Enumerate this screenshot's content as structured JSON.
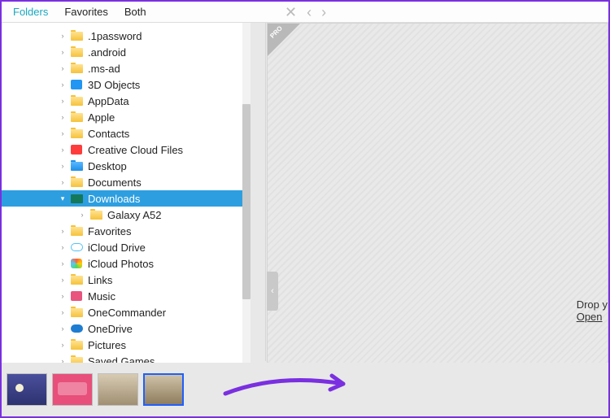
{
  "tabs": {
    "folders": "Folders",
    "favorites": "Favorites",
    "both": "Both",
    "active": "folders"
  },
  "nav": {
    "close": "✕",
    "back": "‹",
    "forward": "›"
  },
  "tree": [
    {
      "label": ".1password",
      "icon": "folder-yellow",
      "chev": "right"
    },
    {
      "label": ".android",
      "icon": "folder-yellow",
      "chev": "right"
    },
    {
      "label": ".ms-ad",
      "icon": "folder-yellow",
      "chev": "right"
    },
    {
      "label": "3D Objects",
      "icon": "icon-3d",
      "chev": "right"
    },
    {
      "label": "AppData",
      "icon": "folder-yellow",
      "chev": "right"
    },
    {
      "label": "Apple",
      "icon": "folder-yellow",
      "chev": "right"
    },
    {
      "label": "Contacts",
      "icon": "folder-yellow",
      "chev": "right"
    },
    {
      "label": "Creative Cloud Files",
      "icon": "icon-cc",
      "chev": "right"
    },
    {
      "label": "Desktop",
      "icon": "folder-blue",
      "chev": "right"
    },
    {
      "label": "Documents",
      "icon": "folder-yellow",
      "chev": "right"
    },
    {
      "label": "Downloads",
      "icon": "icon-downloads-sel",
      "chev": "down",
      "selected": true
    },
    {
      "label": "Galaxy A52",
      "icon": "folder-yellow",
      "chev": "right",
      "child": true
    },
    {
      "label": "Favorites",
      "icon": "folder-yellow",
      "chev": "right"
    },
    {
      "label": "iCloud Drive",
      "icon": "icon-cloud",
      "chev": "right"
    },
    {
      "label": "iCloud Photos",
      "icon": "icon-photos",
      "chev": "right"
    },
    {
      "label": "Links",
      "icon": "folder-yellow",
      "chev": "right"
    },
    {
      "label": "Music",
      "icon": "icon-music",
      "chev": "right"
    },
    {
      "label": "OneCommander",
      "icon": "folder-yellow",
      "chev": "right"
    },
    {
      "label": "OneDrive",
      "icon": "icon-onedrive",
      "chev": "right"
    },
    {
      "label": "Pictures",
      "icon": "folder-yellow",
      "chev": "right"
    },
    {
      "label": "Saved Games",
      "icon": "folder-yellow",
      "chev": "right"
    }
  ],
  "pro_badge": "PRO",
  "drop": {
    "line1": "Drop y",
    "line2": "Open"
  },
  "collapse_glyph": "‹",
  "thumbs_count": 4
}
